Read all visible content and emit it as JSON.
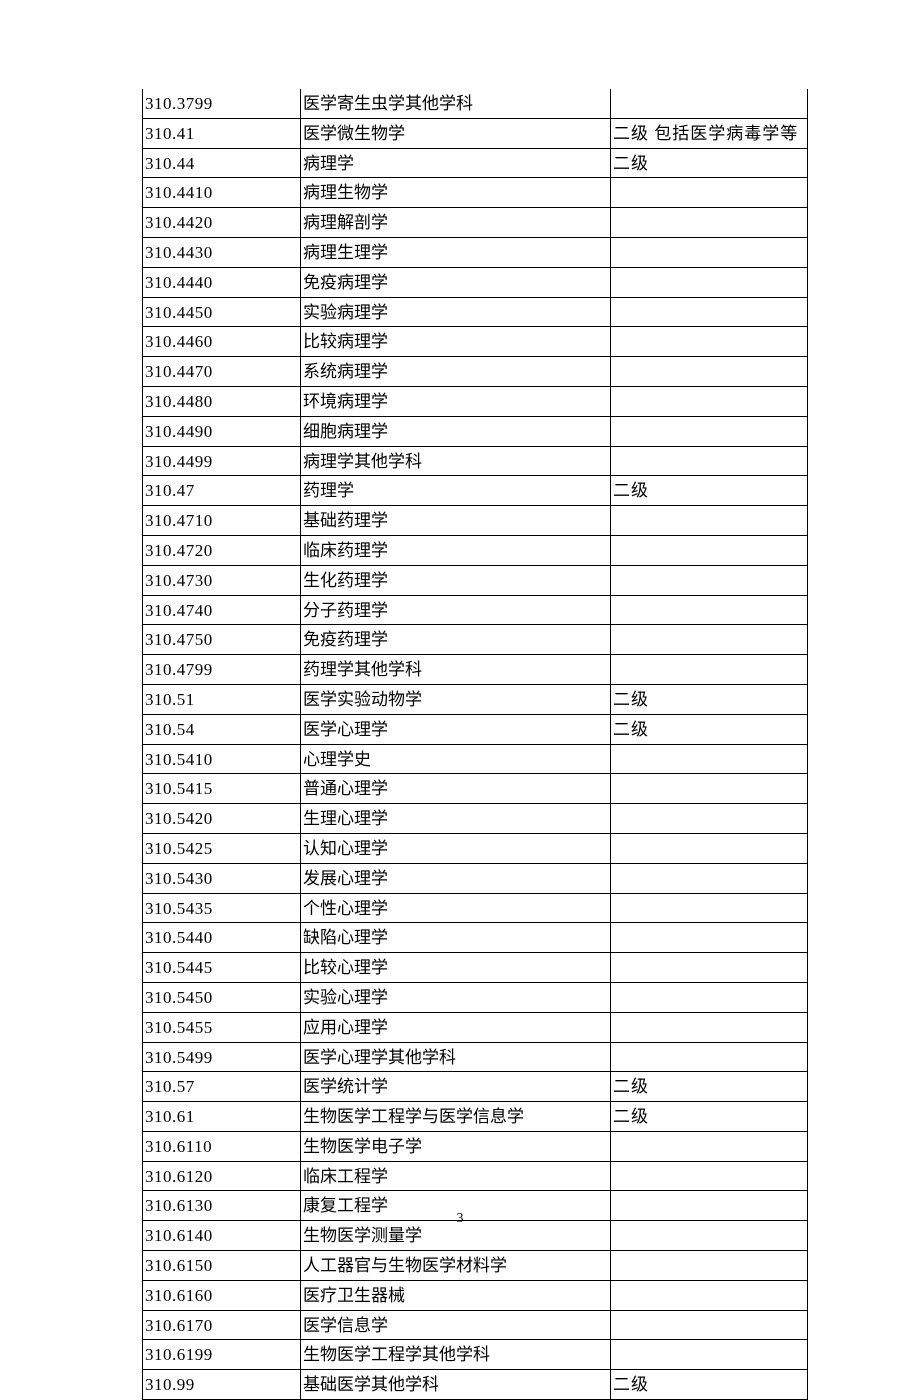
{
  "page_number": "3",
  "rows": [
    {
      "code": "310.3799",
      "name": "医学寄生虫学其他学科",
      "note": ""
    },
    {
      "code": "310.41",
      "name": "医学微生物学",
      "note": "二级 包括医学病毒学等"
    },
    {
      "code": "310.44",
      "name": "病理学",
      "note": "二级"
    },
    {
      "code": "310.4410",
      "name": "病理生物学",
      "note": ""
    },
    {
      "code": "310.4420",
      "name": "病理解剖学",
      "note": ""
    },
    {
      "code": "310.4430",
      "name": "病理生理学",
      "note": ""
    },
    {
      "code": "310.4440",
      "name": "免疫病理学",
      "note": ""
    },
    {
      "code": "310.4450",
      "name": "实验病理学",
      "note": ""
    },
    {
      "code": "310.4460",
      "name": "比较病理学",
      "note": ""
    },
    {
      "code": "310.4470",
      "name": "系统病理学",
      "note": ""
    },
    {
      "code": "310.4480",
      "name": "环境病理学",
      "note": ""
    },
    {
      "code": "310.4490",
      "name": "细胞病理学",
      "note": ""
    },
    {
      "code": "310.4499",
      "name": "病理学其他学科",
      "note": ""
    },
    {
      "code": "310.47",
      "name": "药理学",
      "note": "二级"
    },
    {
      "code": "310.4710",
      "name": "基础药理学",
      "note": ""
    },
    {
      "code": "310.4720",
      "name": "临床药理学",
      "note": ""
    },
    {
      "code": "310.4730",
      "name": "生化药理学",
      "note": ""
    },
    {
      "code": "310.4740",
      "name": "分子药理学",
      "note": ""
    },
    {
      "code": "310.4750",
      "name": "免疫药理学",
      "note": ""
    },
    {
      "code": "310.4799",
      "name": "药理学其他学科",
      "note": ""
    },
    {
      "code": "310.51",
      "name": "医学实验动物学",
      "note": "二级"
    },
    {
      "code": "310.54",
      "name": "医学心理学",
      "note": "二级"
    },
    {
      "code": "310.5410",
      "name": "心理学史",
      "note": ""
    },
    {
      "code": "310.5415",
      "name": "普通心理学",
      "note": ""
    },
    {
      "code": "310.5420",
      "name": "生理心理学",
      "note": ""
    },
    {
      "code": "310.5425",
      "name": "认知心理学",
      "note": ""
    },
    {
      "code": "310.5430",
      "name": "发展心理学",
      "note": ""
    },
    {
      "code": "310.5435",
      "name": "个性心理学",
      "note": ""
    },
    {
      "code": "310.5440",
      "name": "缺陷心理学",
      "note": ""
    },
    {
      "code": "310.5445",
      "name": "比较心理学",
      "note": ""
    },
    {
      "code": "310.5450",
      "name": "实验心理学",
      "note": ""
    },
    {
      "code": "310.5455",
      "name": "应用心理学",
      "note": ""
    },
    {
      "code": "310.5499",
      "name": "医学心理学其他学科",
      "note": ""
    },
    {
      "code": "310.57",
      "name": "医学统计学",
      "note": "二级"
    },
    {
      "code": "310.61",
      "name": "生物医学工程学与医学信息学",
      "note": "二级"
    },
    {
      "code": "310.6110",
      "name": "生物医学电子学",
      "note": ""
    },
    {
      "code": "310.6120",
      "name": "临床工程学",
      "note": ""
    },
    {
      "code": "310.6130",
      "name": "康复工程学",
      "note": ""
    },
    {
      "code": "310.6140",
      "name": "生物医学测量学",
      "note": ""
    },
    {
      "code": "310.6150",
      "name": "人工器官与生物医学材料学",
      "note": ""
    },
    {
      "code": "310.6160",
      "name": "医疗卫生器械",
      "note": ""
    },
    {
      "code": "310.6170",
      "name": "医学信息学",
      "note": ""
    },
    {
      "code": "310.6199",
      "name": "生物医学工程学其他学科",
      "note": ""
    },
    {
      "code": "310.99",
      "name": "基础医学其他学科",
      "note": "二级"
    }
  ]
}
